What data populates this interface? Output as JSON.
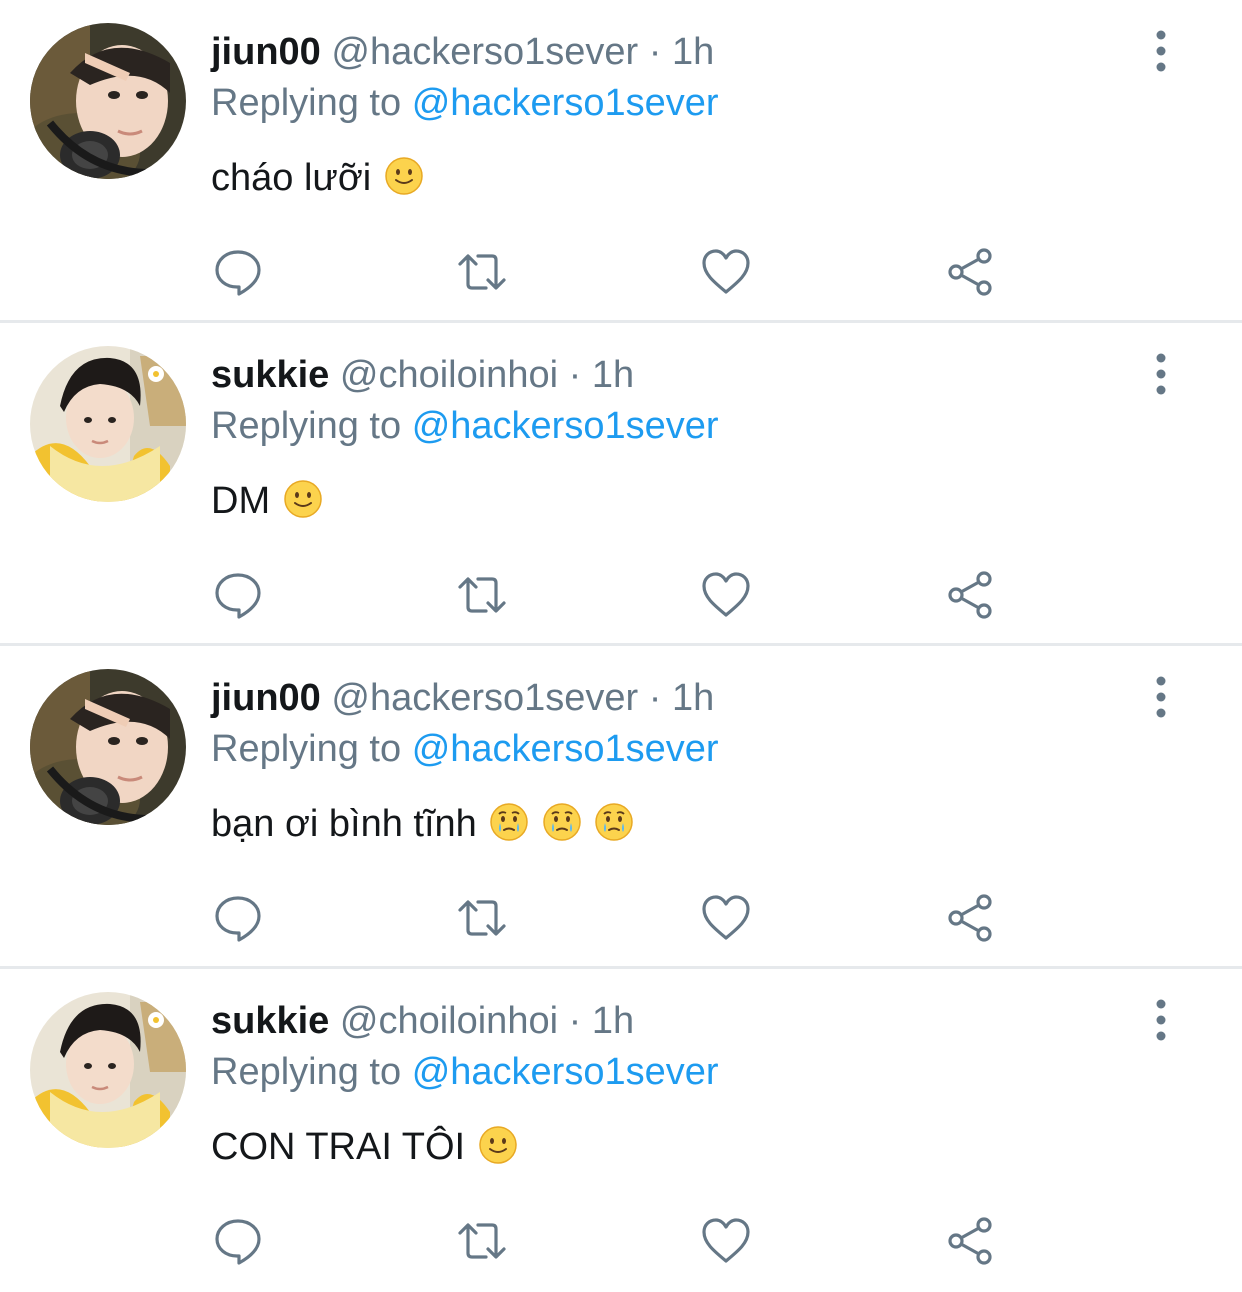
{
  "tweets": [
    {
      "display_name": "jiun00",
      "handle": "@hackerso1sever",
      "separator": "·",
      "time": "1h",
      "replying_label": "Replying to",
      "replying_handle": "@hackerso1sever",
      "text": "cháo lưỡi",
      "emojis": [
        "slightly-smiling-face"
      ],
      "avatar": "jiun00-avatar"
    },
    {
      "display_name": "sukkie",
      "handle": "@choiloinhoi",
      "separator": "·",
      "time": "1h",
      "replying_label": "Replying to",
      "replying_handle": "@hackerso1sever",
      "text": "DM",
      "emojis": [
        "slightly-smiling-face"
      ],
      "avatar": "sukkie-avatar"
    },
    {
      "display_name": "jiun00",
      "handle": "@hackerso1sever",
      "separator": "·",
      "time": "1h",
      "replying_label": "Replying to",
      "replying_handle": "@hackerso1sever",
      "text": "bạn ơi bình tĩnh",
      "emojis": [
        "face-holding-back-tears",
        "face-holding-back-tears",
        "face-holding-back-tears"
      ],
      "avatar": "jiun00-avatar"
    },
    {
      "display_name": "sukkie",
      "handle": "@choiloinhoi",
      "separator": "·",
      "time": "1h",
      "replying_label": "Replying to",
      "replying_handle": "@hackerso1sever",
      "text": "CON TRAI TÔI",
      "emojis": [
        "slightly-smiling-face"
      ],
      "avatar": "sukkie-avatar"
    }
  ],
  "icons": {
    "reply": "reply-bubble-icon",
    "retweet": "retweet-icon",
    "like": "heart-icon",
    "share": "share-icon",
    "more": "more-vertical-icon"
  },
  "colors": {
    "text": "#14171a",
    "secondary": "#657786",
    "link": "#1d9bf0",
    "divider": "#e6e9ec"
  }
}
